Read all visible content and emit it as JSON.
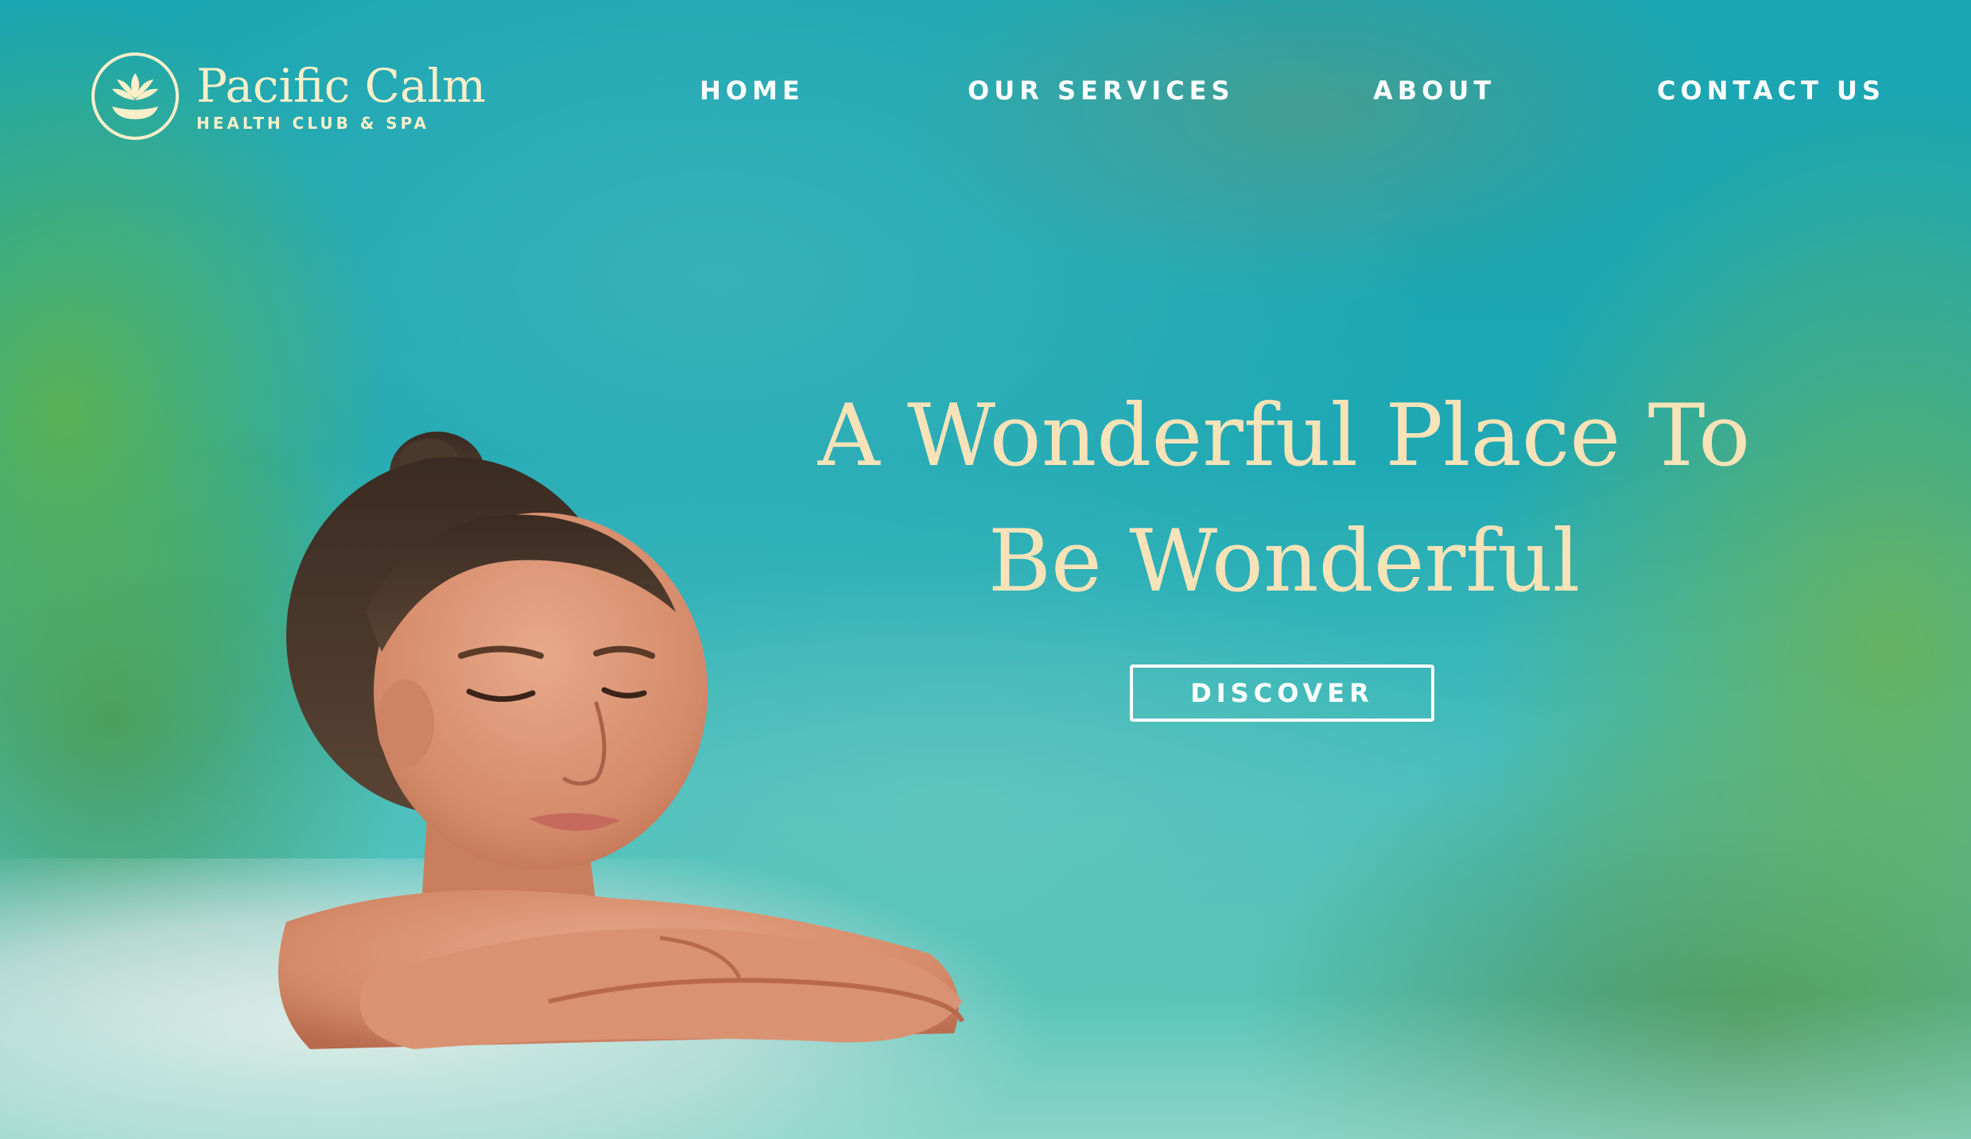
{
  "brand": {
    "name": "Pacific Calm",
    "tagline": "HEALTH CLUB & SPA",
    "logo_icon": "lotus-icon",
    "color": "#fbefc9"
  },
  "nav": {
    "items": [
      {
        "label": "HOME"
      },
      {
        "label": "OUR SERVICES"
      },
      {
        "label": "ABOUT"
      },
      {
        "label": "CONTACT US"
      }
    ]
  },
  "hero": {
    "headline_line1": "A Wonderful Place To",
    "headline_line2": "Be Wonderful",
    "cta_label": "DISCOVER",
    "headline_color": "#f8e3b8",
    "background_color": "#1aa6b1"
  }
}
